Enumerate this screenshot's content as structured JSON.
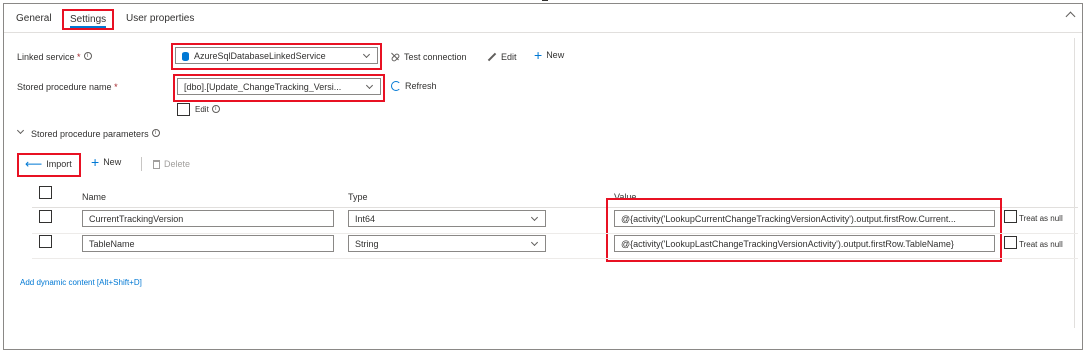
{
  "tabs": {
    "general": "General",
    "settings": "Settings",
    "user_properties": "User properties"
  },
  "linked_service": {
    "label": "Linked service",
    "required": "*",
    "value": "AzureSqlDatabaseLinkedService",
    "test_connection": "Test connection",
    "edit": "Edit",
    "new": "New"
  },
  "stored_procedure": {
    "label": "Stored procedure name",
    "required": "*",
    "value": "[dbo].[Update_ChangeTracking_Versi...",
    "refresh": "Refresh",
    "edit_label": "Edit"
  },
  "parameters": {
    "section_title": "Stored procedure parameters",
    "toolbar": {
      "import": "Import",
      "new": "New",
      "delete": "Delete"
    },
    "columns": {
      "name": "Name",
      "type": "Type",
      "value": "Value"
    },
    "rows": [
      {
        "name": "CurrentTrackingVersion",
        "type": "Int64",
        "value": "@{activity('LookupCurrentChangeTrackingVersionActivity').output.firstRow.Current...",
        "treat_as_null": "Treat as null"
      },
      {
        "name": "TableName",
        "type": "String",
        "value": "@{activity('LookupLastChangeTrackingVersionActivity').output.firstRow.TableName}",
        "treat_as_null": "Treat as null"
      }
    ]
  },
  "dynamic_content_link": "Add dynamic content [Alt+Shift+D]",
  "colors": {
    "accent": "#0078d4",
    "highlight": "#e81123"
  }
}
